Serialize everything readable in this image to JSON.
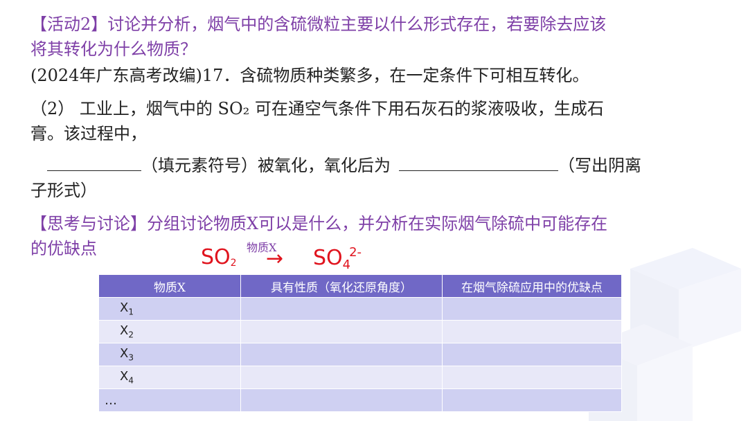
{
  "activity": {
    "line1": "【活动2】讨论并分析，烟气中的含硫微粒主要以什么形式存在，若要除去应该",
    "line2": "将其转化为什么物质？"
  },
  "question": {
    "source_line": "(2024年广东高考改编)17．含硫物质种类繁多，在一定条件下可相互转化。",
    "part_line1": "（2）  工业上，烟气中的 SO₂ 可在通空气条件下用石灰石的浆液吸收，生成石",
    "part_line2": "膏。该过程中，",
    "fill_middle": "（填元素符号）被氧化，氧化后为",
    "fill_end": "（写出阴离",
    "fill_line2": "子形式）"
  },
  "discussion": {
    "line1": "【思考与讨论】分组讨论物质X可以是什么，并分析在实际烟气除硫中可能存在",
    "line2": "的优缺点"
  },
  "formula": {
    "reactant": "SO",
    "reactant_sub": "2",
    "arrow_label": "物质X",
    "arrow": "→",
    "product": "SO",
    "product_sub": "4",
    "product_sup": "2-"
  },
  "table": {
    "headers": [
      "物质X",
      "具有性质（氧化还原角度）",
      "在烟气除硫应用中的优缺点"
    ],
    "rows": [
      {
        "label": "X",
        "sub": "1"
      },
      {
        "label": "X",
        "sub": "2"
      },
      {
        "label": "X",
        "sub": "3"
      },
      {
        "label": "X",
        "sub": "4"
      },
      {
        "label": "…",
        "sub": ""
      }
    ]
  },
  "colors": {
    "accent": "#7e3fa7",
    "formula_red": "#e0141e",
    "table_header": "#7068c6",
    "row_dark": "#cfd0f2",
    "row_light": "#e8e8f8"
  }
}
